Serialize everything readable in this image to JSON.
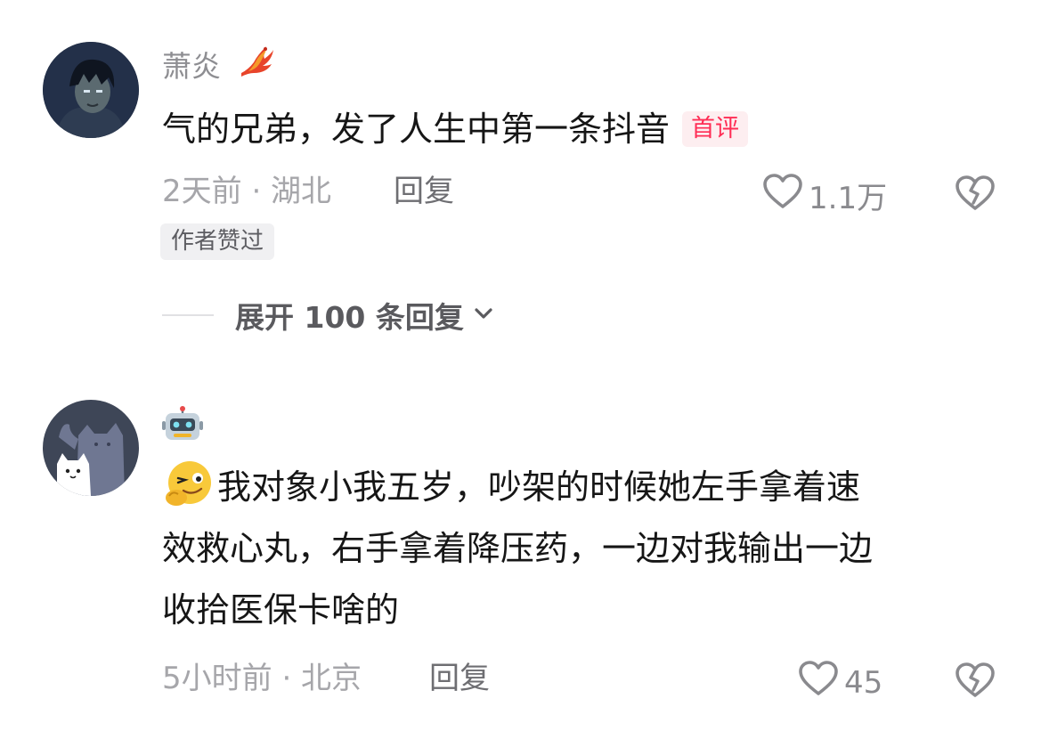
{
  "comments": [
    {
      "username": "萧炎",
      "badge_icon": "phoenix-icon",
      "content": "气的兄弟，发了人生中第一条抖音",
      "first_comment_badge": "首评",
      "time_location": "2天前 · 湖北",
      "reply_label": "回复",
      "like_count": "1.1万",
      "author_liked": "作者赞过",
      "expand_replies": "展开 100 条回复"
    },
    {
      "username_icon": "robot-icon",
      "leading_emoji": "wink-emoji-icon",
      "content_lines": [
        "我对象小我五岁，吵架的时候她左手拿着速",
        "效救心丸，右手拿着降压药，一边对我输出一边",
        "收拾医保卡啥的"
      ],
      "time_location": "5小时前 · 北京",
      "reply_label": "回复",
      "like_count": "45"
    }
  ],
  "colors": {
    "accent": "#ff2d55",
    "badge_bg": "#fdeef0",
    "meta_text": "#a6a6aa",
    "body_text": "#161616"
  }
}
